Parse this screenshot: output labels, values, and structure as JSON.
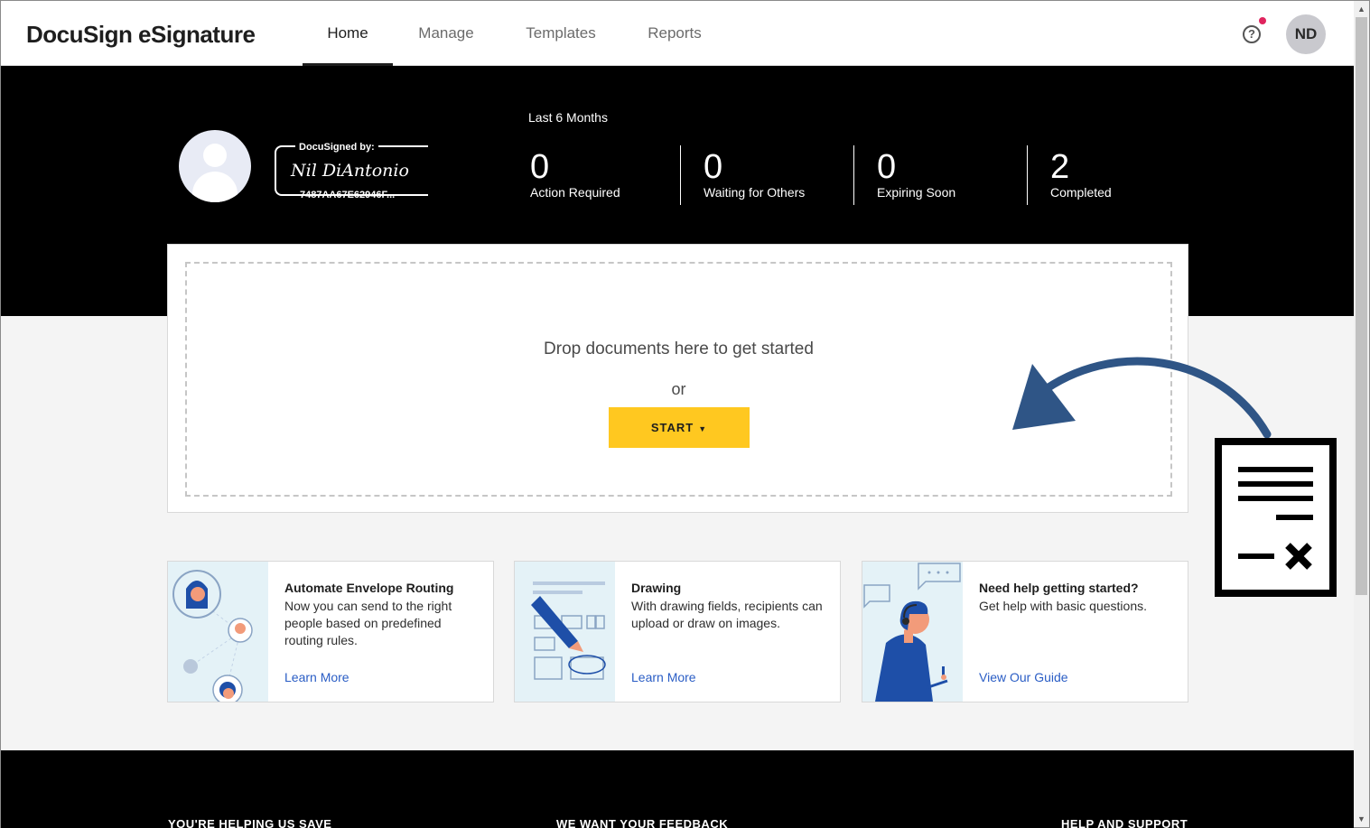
{
  "app": {
    "logo": "DocuSign eSignature"
  },
  "nav": {
    "tabs": [
      {
        "label": "Home",
        "active": true
      },
      {
        "label": "Manage",
        "active": false
      },
      {
        "label": "Templates",
        "active": false
      },
      {
        "label": "Reports",
        "active": false
      }
    ],
    "help_icon_glyph": "?",
    "avatar_initials": "ND"
  },
  "profile": {
    "signature_label": "DocuSigned by:",
    "signature_name": "Nil DiAntonio",
    "signature_id": "7487AA67E62946F..."
  },
  "stats": {
    "period": "Last 6 Months",
    "items": [
      {
        "value": "0",
        "label": "Action Required"
      },
      {
        "value": "0",
        "label": "Waiting for Others"
      },
      {
        "value": "0",
        "label": "Expiring Soon"
      },
      {
        "value": "2",
        "label": "Completed"
      }
    ]
  },
  "dropzone": {
    "prompt": "Drop documents here to get started",
    "or": "or",
    "start_label": "START",
    "start_caret": "▼"
  },
  "cards": [
    {
      "title": "Automate Envelope Routing",
      "description": "Now you can send to the right people based on predefined routing rules.",
      "link": "Learn More"
    },
    {
      "title": "Drawing",
      "description": "With drawing fields, recipients can upload or draw on images.",
      "link": "Learn More"
    },
    {
      "title": "Need help getting started?",
      "description": "Get help with basic questions.",
      "link": "View Our Guide"
    }
  ],
  "footer": {
    "headings": [
      "YOU'RE HELPING US SAVE",
      "WE WANT YOUR FEEDBACK",
      "HELP AND SUPPORT"
    ]
  },
  "colors": {
    "brand_yellow": "#ffc820",
    "link_blue": "#2a5dc5",
    "arrow_blue": "#2f5586",
    "notification_red": "#e0245e"
  },
  "scrollbar": {
    "up_glyph": "▲",
    "down_glyph": "▼"
  }
}
